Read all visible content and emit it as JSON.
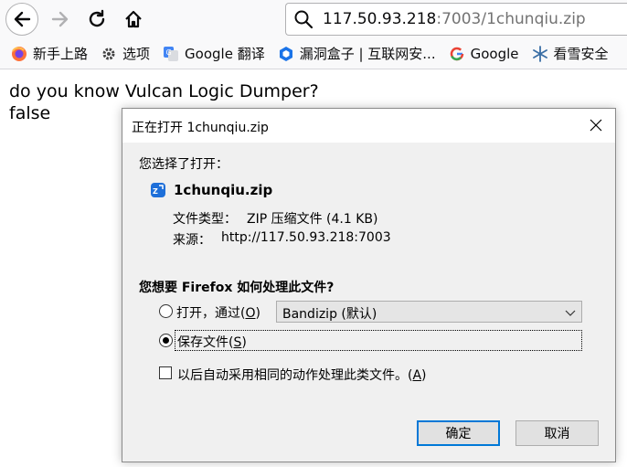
{
  "browser": {
    "url_host": "117.50.93.218",
    "url_rest": ":7003/1chunqiu.zip"
  },
  "bookmarks": [
    {
      "label": "新手上路",
      "icon": "firefox-icon"
    },
    {
      "label": "选项",
      "icon": "gear-icon"
    },
    {
      "label": "Google 翻译",
      "icon": "translate-icon"
    },
    {
      "label": "漏洞盒子 | 互联网安...",
      "icon": "shield-icon"
    },
    {
      "label": "Google",
      "icon": "google-icon"
    },
    {
      "label": "看雪安全",
      "icon": "snowflake-icon"
    }
  ],
  "page": {
    "line1": "do you know Vulcan Logic Dumper?",
    "line2": "false"
  },
  "dialog": {
    "title": "正在打开 1chunqiu.zip",
    "you_chose": "您选择了打开：",
    "file_name": "1chunqiu.zip",
    "type_label": "文件类型：",
    "type_value": "ZIP 压缩文件 (4.1 KB)",
    "source_label": "来源：",
    "source_value": "http://117.50.93.218:7003",
    "question": "您想要 Firefox 如何处理此文件?",
    "open_with_prefix": "打开，通过(",
    "open_with_key": "O",
    "open_with_suffix": ")",
    "open_app": "Bandizip (默认)",
    "save_prefix": "保存文件(",
    "save_key": "S",
    "save_suffix": ")",
    "auto_prefix": "以后自动采用相同的动作处理此类文件。(",
    "auto_key": "A",
    "auto_suffix": ")",
    "ok_label": "确定",
    "cancel_label": "取消",
    "selected_action": "save"
  }
}
